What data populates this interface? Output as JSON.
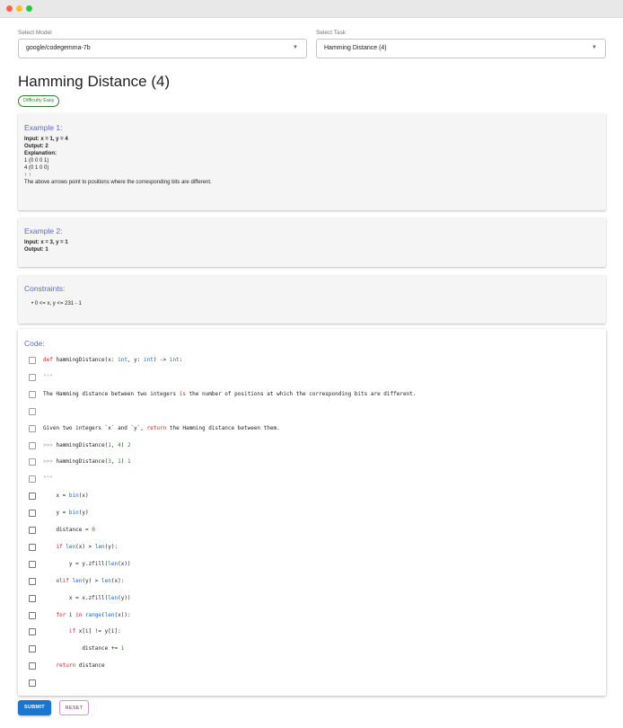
{
  "model_select": {
    "label": "Select Model",
    "value": "google/codegemma-7b"
  },
  "task_select": {
    "label": "Select Task",
    "value": "Hamming Distance (4)"
  },
  "page": {
    "title": "Hamming Distance (4)",
    "difficulty": "Difficulty Easy"
  },
  "example1": {
    "title": "Example 1:",
    "input": "Input: x = 1, y = 4",
    "output": "Output: 2",
    "explanation_label": "Explanation:",
    "lines": [
      "1 (0 0 0 1)",
      "4 (0 1 0 0)",
      "↑ ↑",
      "The above arrows point to positions where the corresponding bits are different."
    ]
  },
  "example2": {
    "title": "Example 2:",
    "input": "Input: x = 3, y = 1",
    "output": "Output: 1"
  },
  "constraints": {
    "title": "Constraints:",
    "items": [
      "0 <= x, y <= 231 - 1"
    ]
  },
  "code": {
    "title": "Code:",
    "lines": [
      {
        "tokens": [
          [
            "def ",
            "kw"
          ],
          [
            "hammingDistance",
            "fn"
          ],
          [
            "(x: ",
            ""
          ],
          [
            "int",
            "bi"
          ],
          [
            ", y: ",
            ""
          ],
          [
            "int",
            "bi"
          ],
          [
            ") -> ",
            ""
          ],
          [
            "int",
            "bi"
          ],
          [
            ":",
            ""
          ]
        ]
      },
      {
        "tokens": [
          [
            "\"\"\"",
            "cm"
          ]
        ]
      },
      {
        "tokens": [
          [
            "The Hamming distance between two integers ",
            ""
          ],
          [
            "is",
            "kw"
          ],
          [
            " the number of positions at which the corresponding bits are different.",
            ""
          ]
        ]
      },
      {
        "tokens": []
      },
      {
        "tokens": [
          [
            "Given two integers `x` and `y`, ",
            ""
          ],
          [
            "return",
            "kw"
          ],
          [
            " the Hamming distance between them.",
            ""
          ]
        ]
      },
      {
        "tokens": [
          [
            ">>> ",
            "cm"
          ],
          [
            "hammingDistance",
            "fn"
          ],
          [
            "(",
            ""
          ],
          [
            "1",
            "num"
          ],
          [
            ", ",
            ""
          ],
          [
            "4",
            "num"
          ],
          [
            ") ",
            ""
          ],
          [
            "2",
            "num"
          ]
        ]
      },
      {
        "tokens": [
          [
            ">>> ",
            "cm"
          ],
          [
            "hammingDistance",
            "fn"
          ],
          [
            "(",
            ""
          ],
          [
            "3",
            "num"
          ],
          [
            ", ",
            ""
          ],
          [
            "1",
            "num"
          ],
          [
            ") ",
            ""
          ],
          [
            "1",
            "num"
          ]
        ]
      },
      {
        "tokens": [
          [
            "\"\"\"",
            "cm"
          ]
        ]
      },
      {
        "tokens": [
          [
            "    x = ",
            ""
          ],
          [
            "bin",
            "bi"
          ],
          [
            "(x)",
            ""
          ]
        ]
      },
      {
        "tokens": [
          [
            "    y = ",
            ""
          ],
          [
            "bin",
            "bi"
          ],
          [
            "(y)",
            ""
          ]
        ]
      },
      {
        "tokens": [
          [
            "    distance = ",
            ""
          ],
          [
            "0",
            "num"
          ]
        ]
      },
      {
        "tokens": [
          [
            "    ",
            ""
          ],
          [
            "if ",
            "kw"
          ],
          [
            "len",
            "bi"
          ],
          [
            "(x) > ",
            ""
          ],
          [
            "len",
            "bi"
          ],
          [
            "(y):",
            ""
          ]
        ]
      },
      {
        "tokens": [
          [
            "        y = y.zfill(",
            ""
          ],
          [
            "len",
            "bi"
          ],
          [
            "(x))",
            ""
          ]
        ]
      },
      {
        "tokens": [
          [
            "    ",
            ""
          ],
          [
            "elif ",
            "kw"
          ],
          [
            "len",
            "bi"
          ],
          [
            "(y) > ",
            ""
          ],
          [
            "len",
            "bi"
          ],
          [
            "(x):",
            ""
          ]
        ]
      },
      {
        "tokens": [
          [
            "        x = x.zfill(",
            ""
          ],
          [
            "len",
            "bi"
          ],
          [
            "(y))",
            ""
          ]
        ]
      },
      {
        "tokens": [
          [
            "    ",
            ""
          ],
          [
            "for ",
            "kw"
          ],
          [
            "i ",
            ""
          ],
          [
            "in ",
            "kw"
          ],
          [
            "range",
            "bi"
          ],
          [
            "(",
            ""
          ],
          [
            "len",
            "bi"
          ],
          [
            "(x)):",
            ""
          ]
        ]
      },
      {
        "tokens": [
          [
            "        ",
            ""
          ],
          [
            "if ",
            "kw"
          ],
          [
            "x[i] != y[i]:",
            ""
          ]
        ]
      },
      {
        "tokens": [
          [
            "            distance += ",
            ""
          ],
          [
            "1",
            "num"
          ]
        ]
      },
      {
        "tokens": [
          [
            "    ",
            ""
          ],
          [
            "return ",
            "kw"
          ],
          [
            "distance",
            ""
          ]
        ]
      },
      {
        "tokens": []
      }
    ]
  },
  "buttons": {
    "submit": "SUBMIT",
    "reset": "RESET"
  }
}
